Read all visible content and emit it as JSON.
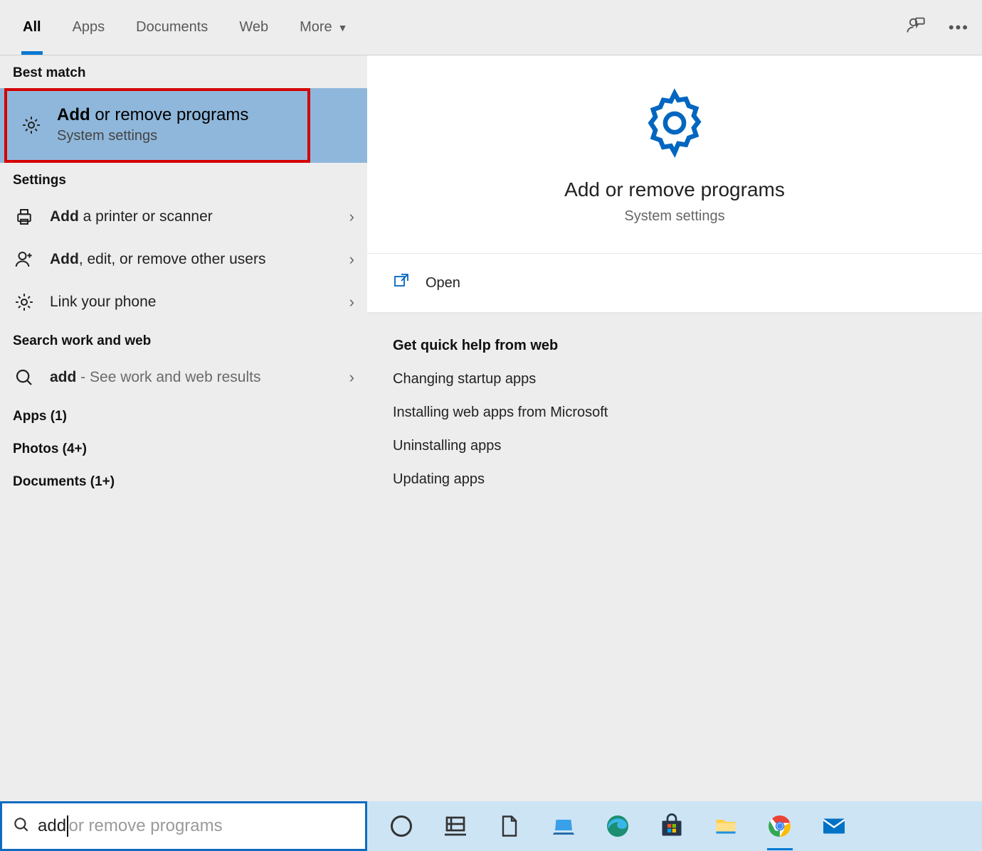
{
  "tabs": {
    "all": "All",
    "apps": "Apps",
    "documents": "Documents",
    "web": "Web",
    "more": "More"
  },
  "left": {
    "best_match_header": "Best match",
    "best_match": {
      "title_bold": "Add",
      "title_rest": " or remove programs",
      "subtitle": "System settings"
    },
    "settings_header": "Settings",
    "settings_items": [
      {
        "bold": "Add",
        "rest": " a printer or scanner"
      },
      {
        "bold": "Add",
        "rest": ", edit, or remove other users"
      },
      {
        "bold": "",
        "rest": "Link your phone"
      }
    ],
    "search_web_header": "Search work and web",
    "search_web_item": {
      "bold": "add",
      "rest": " - See work and web results"
    },
    "apps_header": "Apps (1)",
    "photos_header": "Photos (4+)",
    "documents_header": "Documents (1+)"
  },
  "right": {
    "title": "Add or remove programs",
    "subtitle": "System settings",
    "open_label": "Open",
    "help_header": "Get quick help from web",
    "help_links": [
      "Changing startup apps",
      "Installing web apps from Microsoft",
      "Uninstalling apps",
      "Updating apps"
    ]
  },
  "search": {
    "typed": "add",
    "ghost": " or remove programs"
  }
}
